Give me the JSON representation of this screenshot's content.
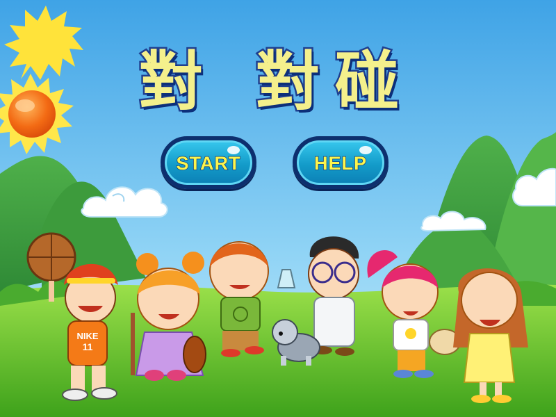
{
  "title": "對 對碰",
  "buttons": {
    "start_label": "START",
    "help_label": "HELP"
  },
  "characters": [
    {
      "name": "basketball-boy",
      "shirt_text": "NIKE",
      "shirt_number": "11"
    },
    {
      "name": "violin-girl"
    },
    {
      "name": "green-shirt-boy"
    },
    {
      "name": "scientist-boy"
    },
    {
      "name": "dog"
    },
    {
      "name": "painter-girl"
    },
    {
      "name": "apron-girl"
    }
  ],
  "colors": {
    "sky": "#6fc0ef",
    "grass": "#5cbf2a",
    "title_fill": "#f4f08c",
    "title_stroke": "#1f3f8f",
    "button_fill": "#1ea9d8",
    "button_text": "#fcf54b"
  }
}
